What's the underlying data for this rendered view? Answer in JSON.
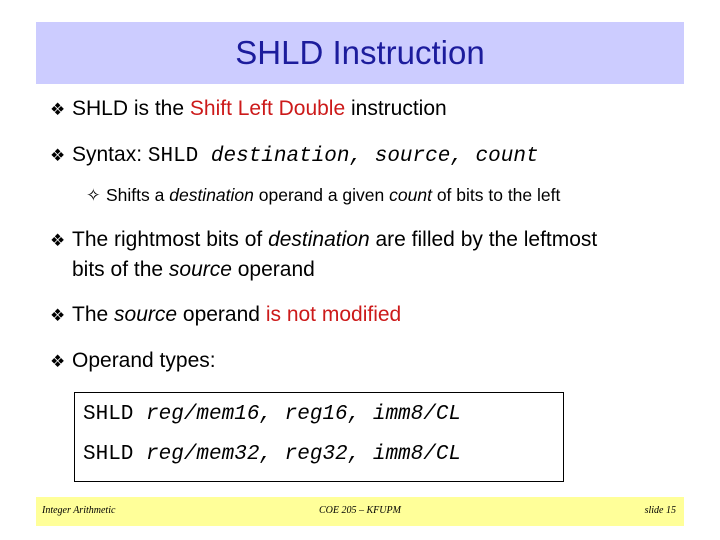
{
  "title": "SHLD Instruction",
  "bullets": {
    "b1": {
      "pre": "SHLD is the ",
      "red": "Shift Left Double",
      "post": " instruction"
    },
    "b2": {
      "pre": "Syntax: ",
      "code": "SHLD ",
      "args": "destination, source, count"
    },
    "b2sub": {
      "pre": "Shifts a ",
      "em1": "destination",
      "mid": " operand a given ",
      "em2": "count",
      "post": " of bits to the left"
    },
    "b3": {
      "pre": "The rightmost bits of ",
      "em1": "destination",
      "mid": " are filled by the leftmost",
      "line2pre": "bits of the ",
      "em2": "source",
      "post": " operand"
    },
    "b4": {
      "pre": "The ",
      "em": "source",
      "mid": " operand ",
      "red": "is not modified"
    },
    "b5": {
      "text": "Operand types:"
    }
  },
  "code_lines": [
    {
      "op": "SHLD ",
      "args": "reg/mem16, reg16, imm8/CL"
    },
    {
      "op": "SHLD ",
      "args": "reg/mem32, reg32, imm8/CL"
    }
  ],
  "footer": {
    "left": "Integer Arithmetic",
    "center": "COE 205 – KFUPM",
    "right": "slide 15"
  },
  "icons": {
    "bullet": "diamond-four-bullet",
    "sub_bullet": "four-point-star-outline"
  },
  "colors": {
    "title_bar": "#ccccff",
    "title_text": "#1c1c9c",
    "highlight": "#cc1a1a",
    "footer": "#ffff99"
  }
}
